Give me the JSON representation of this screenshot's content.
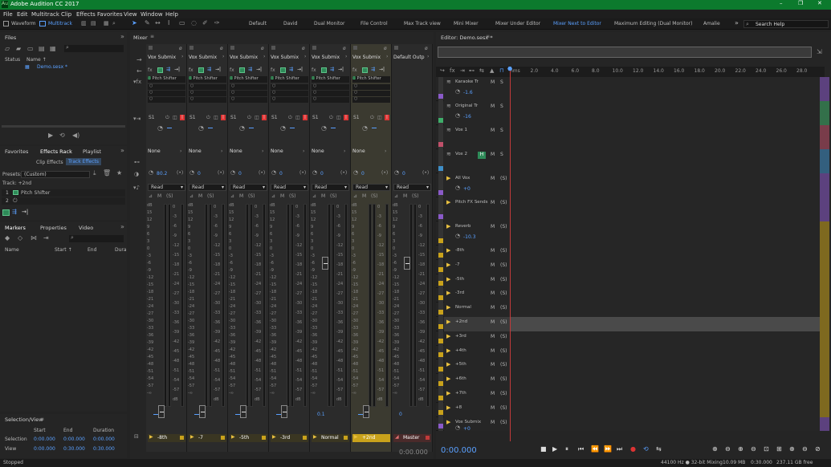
{
  "app": {
    "title": "Adobe Audition CC 2017",
    "window_buttons": [
      "–",
      "❐",
      "✕"
    ]
  },
  "menu": [
    "File",
    "Edit",
    "Multitrack",
    "Clip",
    "Effects",
    "Favorites",
    "View",
    "Window",
    "Help"
  ],
  "toolbar": {
    "waveform": "Waveform",
    "multitrack": "Multitrack",
    "workspaces": [
      "Default",
      "David",
      "Dual Monitor",
      "File Control",
      "Max Track view",
      "Mini Mixer",
      "Mixer Under Editor",
      "Mixer Next to Editor",
      "Maximum Editing (Dual Monitor)",
      "Amalie"
    ],
    "active_workspace": "Mixer Next to Editor",
    "search_placeholder": "Search Help",
    "overflow": "»"
  },
  "files": {
    "title": "Files",
    "col_status": "Status",
    "col_name": "Name ↑",
    "item": "Demo.sesx *"
  },
  "effects": {
    "tabs": [
      "Favorites",
      "Effects Rack",
      "Playlist"
    ],
    "subtabs": [
      "Clip Effects",
      "Track Effects"
    ],
    "presets_label": "Presets:",
    "presets_value": "(Custom)",
    "track_label": "Track: +2nd",
    "slots": [
      {
        "num": "1",
        "name": "Pitch Shifter"
      },
      {
        "num": "2",
        "name": ""
      }
    ]
  },
  "markers": {
    "tabs": [
      "Markers",
      "Properties",
      "Video"
    ],
    "cols": [
      "Name",
      "Start ↑",
      "End",
      "Dura"
    ]
  },
  "selection_view": {
    "title": "Selection/View",
    "cols": [
      "Start",
      "End",
      "Duration"
    ],
    "rows": [
      {
        "label": "Selection",
        "start": "0:00.000",
        "end": "0:00.000",
        "dur": "0:00.000"
      },
      {
        "label": "View",
        "start": "0:00.000",
        "end": "0:30.000",
        "dur": "0:30.000"
      }
    ]
  },
  "mixer": {
    "title": "Mixer",
    "strips": [
      {
        "output": "Vox Submix",
        "fx": "Pitch Shifter",
        "send": "S1",
        "send_target": "None",
        "pan": "0",
        "mode": "Read",
        "vol": "",
        "name": "-8th"
      },
      {
        "output": "Vox Submix",
        "fx": "Pitch Shifter",
        "send": "S1",
        "send_target": "None",
        "pan": "0",
        "mode": "Read",
        "vol": "",
        "name": "-7"
      },
      {
        "output": "Vox Submix",
        "fx": "Pitch Shifter",
        "send": "S1",
        "send_target": "None",
        "pan": "0",
        "mode": "Read",
        "vol": "",
        "name": "-5th"
      },
      {
        "output": "Vox Submix",
        "fx": "Pitch Shifter",
        "send": "S1",
        "send_target": "None",
        "pan": "0",
        "mode": "Read",
        "vol": "",
        "name": "-3rd"
      },
      {
        "output": "Vox Submix",
        "fx": "Pitch Shifter",
        "send": "S1",
        "send_target": "None",
        "pan": "0",
        "mode": "Read",
        "vol": "0.1",
        "name": "Normal"
      },
      {
        "output": "Vox Submix",
        "fx": "Pitch Shifter",
        "send": "S1",
        "send_target": "None",
        "pan": "0",
        "mode": "Read",
        "vol": "",
        "name": "+2nd"
      },
      {
        "output": "Default Outp",
        "fx": "",
        "send": "",
        "send_target": "",
        "pan": "0",
        "mode": "Read",
        "vol": "0",
        "name": "Master"
      }
    ],
    "first_pan": "80.2",
    "db_ticks": [
      "dB",
      "15",
      "12",
      "9",
      "6",
      "3",
      "0",
      "-3",
      "-6",
      "-9",
      "-12",
      "-15",
      "-18",
      "-21",
      "-24",
      "-27",
      "-30",
      "-33",
      "-36",
      "-39",
      "-42",
      "-45",
      "-48",
      "-51",
      "-54",
      "-57",
      "-∞"
    ],
    "meter_ticks": [
      "0",
      "-3",
      "-6",
      "-9",
      "-12",
      "-15",
      "-18",
      "-21",
      "-24",
      "-27",
      "-30",
      "-33",
      "-36",
      "-39",
      "-42",
      "-45",
      "-48",
      "-51",
      "-54",
      "-57",
      "dB"
    ],
    "time": "0:00.000"
  },
  "editor": {
    "title": "Editor: Demo.sesx *",
    "ruler": [
      "hms",
      "2.0",
      "4.0",
      "6.0",
      "8.0",
      "10.0",
      "12.0",
      "14.0",
      "16.0",
      "18.0",
      "20.0",
      "22.0",
      "24.0",
      "26.0",
      "28.0"
    ],
    "tracks": [
      {
        "name": "Karaoke Tr",
        "val": "-1.6",
        "color": "#8a5ac8",
        "kind": "audio"
      },
      {
        "name": "Original Tr",
        "val": "-16",
        "color": "#3fae6a",
        "kind": "audio"
      },
      {
        "name": "Vox 1",
        "val": "",
        "color": "#c0506a",
        "kind": "audio"
      },
      {
        "name": "Vox 2",
        "val": "",
        "color": "#3f8fc8",
        "kind": "audio"
      },
      {
        "name": "All Vox",
        "val": "+0",
        "color": "#8a5ac8",
        "kind": "bus"
      },
      {
        "name": "Pitch FX Sends",
        "val": "",
        "color": "#8a5ac8",
        "kind": "bus"
      },
      {
        "name": "Reverb",
        "val": "-10.3",
        "color": "#c9a21b",
        "kind": "bus"
      },
      {
        "name": "-8th",
        "val": "",
        "color": "#c9a21b",
        "kind": "bus"
      },
      {
        "name": "-7",
        "val": "",
        "color": "#c9a21b",
        "kind": "bus"
      },
      {
        "name": "-5th",
        "val": "",
        "color": "#c9a21b",
        "kind": "bus"
      },
      {
        "name": "-3rd",
        "val": "",
        "color": "#c9a21b",
        "kind": "bus"
      },
      {
        "name": "Normal",
        "val": "",
        "color": "#c9a21b",
        "kind": "bus"
      },
      {
        "name": "+2nd",
        "val": "",
        "color": "#c9a21b",
        "kind": "bus"
      },
      {
        "name": "+3rd",
        "val": "",
        "color": "#c9a21b",
        "kind": "bus"
      },
      {
        "name": "+4th",
        "val": "",
        "color": "#c9a21b",
        "kind": "bus"
      },
      {
        "name": "+5th",
        "val": "",
        "color": "#c9a21b",
        "kind": "bus"
      },
      {
        "name": "+6th",
        "val": "",
        "color": "#c9a21b",
        "kind": "bus"
      },
      {
        "name": "+7th",
        "val": "",
        "color": "#c9a21b",
        "kind": "bus"
      },
      {
        "name": "+8",
        "val": "",
        "color": "#c9a21b",
        "kind": "bus"
      },
      {
        "name": "Vox Submix",
        "val": "+0",
        "color": "#8a5ac8",
        "kind": "bus"
      }
    ],
    "time": "0:00.000"
  },
  "status": {
    "left": "Stopped",
    "sample": "44100 Hz ● 32-bit Mixing",
    "size": "10.09 MB",
    "dur": "0:30.000",
    "free": "237.11 GB free"
  },
  "colors": {
    "title_bar": "#0c7a2d",
    "accent": "#5aa0ff",
    "playhead": "#3a8dff",
    "highlight": "#c9a21b"
  }
}
